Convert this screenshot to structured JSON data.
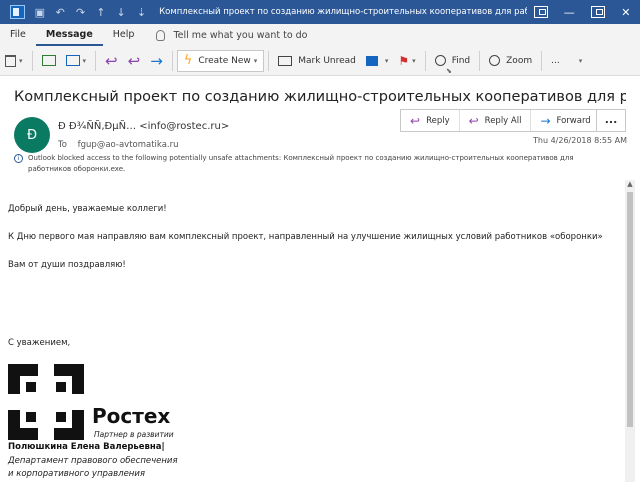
{
  "window": {
    "title": "Комплексный проект по созданию жилищно-строительных кооперативов для работников «об...",
    "qa_save_icon": "save-icon",
    "qa_undo_icon": "undo-icon",
    "qa_redo_icon": "redo-icon",
    "qa_up_icon": "arrow-up-icon",
    "qa_down_icon": "arrow-down-icon",
    "minimize": "—",
    "close": "✕"
  },
  "menu": {
    "tabs": [
      {
        "label": "File"
      },
      {
        "label": "Message"
      },
      {
        "label": "Help"
      }
    ],
    "tell_me": "Tell me what you want to do"
  },
  "toolbar": {
    "create_new": "Create New",
    "mark_unread": "Mark Unread",
    "find": "Find",
    "zoom": "Zoom",
    "more": "..."
  },
  "message": {
    "subject": "Комплексный проект по созданию жилищно-строительных кооперативов для работников «...",
    "avatar_initial": "Ð",
    "sender": "Ð Ð¾ÑÑ‚ÐµÑ… <info@rostec.ru>",
    "to_label": "To",
    "to": "fgup@ao-avtomatika.ru",
    "reply": "Reply",
    "reply_all": "Reply All",
    "forward": "Forward",
    "more": "...",
    "date": "Thu 4/26/2018 8:55 AM",
    "info_icon": "i",
    "info": "Outlook blocked access to the following potentially unsafe attachments: Комплексный проект по созданию жилищно-строительных кооперативов для работников оборонки.exe."
  },
  "body": {
    "greeting": "Добрый день, уважаемые коллеги!",
    "line1": "К Дню первого мая направляю вам комплексный проект,   направленный на улучшение жилищных условий работников «оборонки»",
    "line2": "Вам от души поздравляю!",
    "regards": "С уважением,"
  },
  "signature": {
    "brand": "Ростех",
    "tagline": "Партнер в развитии",
    "name": "Полюшкина Елена Валерьевна|",
    "dept1": "Департамент правового обеспечения",
    "dept2": "и корпоративного управления"
  },
  "colors": {
    "titlebar": "#2b5797",
    "avatar": "#0b7a63",
    "accent_purple": "#8e44ad",
    "accent_blue": "#1976d2"
  }
}
